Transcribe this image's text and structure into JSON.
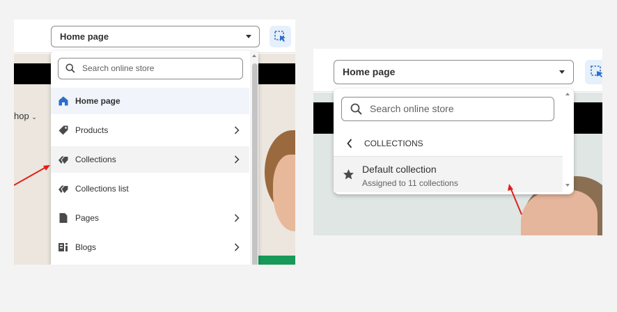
{
  "left_panel": {
    "page_selector": {
      "value": "Home page"
    },
    "search": {
      "placeholder": "Search online store"
    },
    "shop_fragment": "hop",
    "menu_items": [
      {
        "label": "Home page",
        "icon": "home-icon",
        "selected": true
      },
      {
        "label": "Products",
        "icon": "tag-icon",
        "has_submenu": true
      },
      {
        "label": "Collections",
        "icon": "collection-tags-icon",
        "has_submenu": true
      },
      {
        "label": "Collections list",
        "icon": "collection-tags-icon"
      },
      {
        "label": "Pages",
        "icon": "page-icon",
        "has_submenu": true
      },
      {
        "label": "Blogs",
        "icon": "blog-icon",
        "has_submenu": true
      }
    ]
  },
  "right_panel": {
    "page_selector": {
      "value": "Home page"
    },
    "search": {
      "placeholder": "Search online store"
    },
    "back_label": "COLLECTIONS",
    "result": {
      "title": "Default collection",
      "subtitle": "Assigned to 11 collections",
      "icon": "star-icon"
    }
  },
  "colors": {
    "accent_blue": "#2c6ecb",
    "arrow_red": "#e0201b",
    "selected_row": "#f1f4fb"
  }
}
